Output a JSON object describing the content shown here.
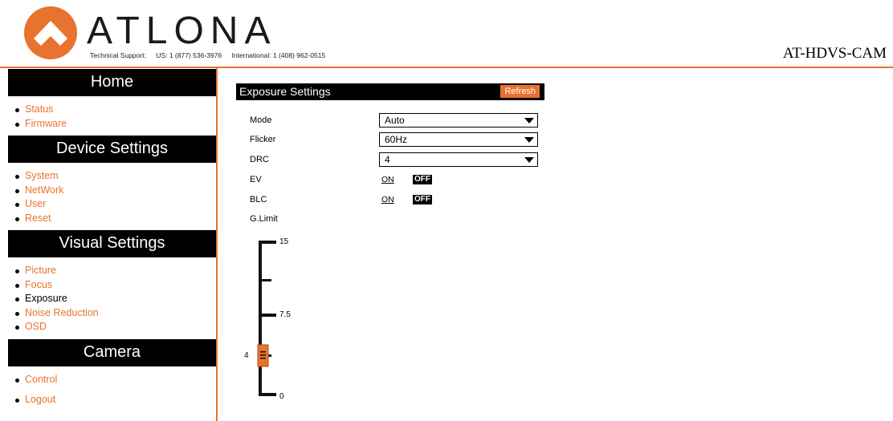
{
  "header": {
    "brand": "ATLONA",
    "support_label": "Technical Support:",
    "support_us": "US: 1 (877) 536-3976",
    "support_intl": "International: 1 (408) 962-0515",
    "model": "AT-HDVS-CAM"
  },
  "sidebar": {
    "sections": [
      {
        "title": "Home",
        "items": [
          "Status",
          "Firmware"
        ]
      },
      {
        "title": "Device Settings",
        "items": [
          "System",
          "NetWork",
          "User",
          "Reset"
        ]
      },
      {
        "title": "Visual Settings",
        "items": [
          "Picture",
          "Focus",
          "Exposure",
          "Noise Reduction",
          "OSD"
        ]
      },
      {
        "title": "Camera",
        "items": [
          "Control",
          "Logout"
        ]
      }
    ],
    "current_item": "Exposure"
  },
  "panel": {
    "title": "Exposure Settings",
    "refresh_label": "Refresh",
    "mode_label": "Mode",
    "mode_value": "Auto",
    "flicker_label": "Flicker",
    "flicker_value": "60Hz",
    "drc_label": "DRC",
    "drc_value": "4",
    "ev_label": "EV",
    "ev_on": "ON",
    "ev_off": "OFF",
    "blc_label": "BLC",
    "blc_on": "ON",
    "blc_off": "OFF",
    "glimit_label": "G.Limit",
    "glimit_value": "4",
    "glimit_max": "15",
    "glimit_mid": "7.5",
    "glimit_min": "0"
  },
  "colors": {
    "accent": "#e8732e",
    "dark": "#000000"
  }
}
